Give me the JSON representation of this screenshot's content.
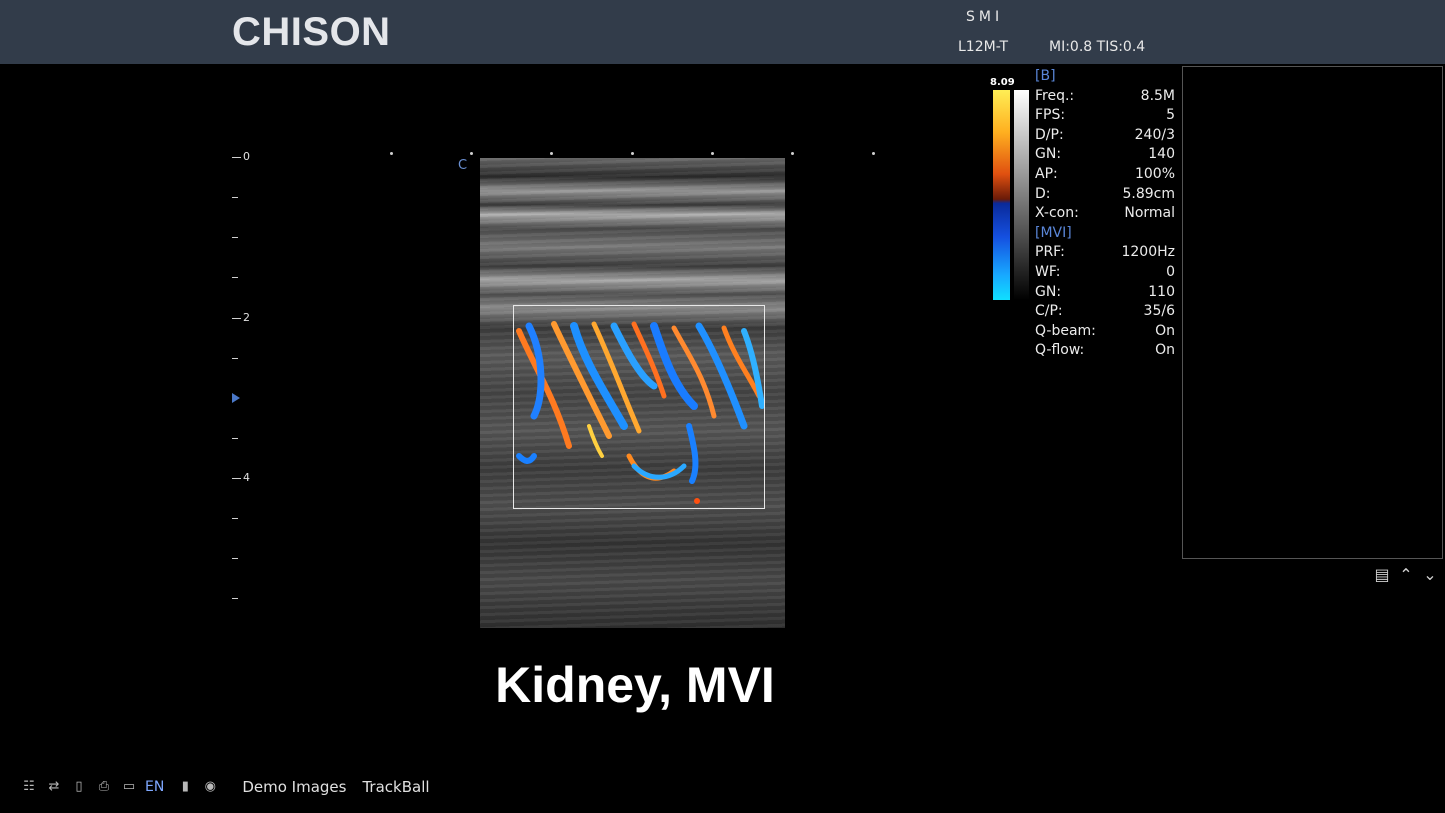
{
  "header": {
    "brand": "CHISON",
    "mode": "SMI",
    "probe": "L12M-T",
    "mi_tis": "MI:0.8 TIS:0.4"
  },
  "ruler": {
    "labels": [
      "0",
      "2",
      "4"
    ],
    "orientation_marker": "C"
  },
  "colorbar": {
    "max_label": "8.09"
  },
  "params": {
    "b_section": "[B]",
    "b_rows": [
      {
        "label": "Freq.:",
        "value": "8.5M"
      },
      {
        "label": "FPS:",
        "value": "5"
      },
      {
        "label": "D/P:",
        "value": "240/3"
      },
      {
        "label": "GN:",
        "value": "140"
      },
      {
        "label": "AP:",
        "value": "100%"
      },
      {
        "label": "D:",
        "value": "5.89cm"
      },
      {
        "label": "X-con:",
        "value": "Normal"
      }
    ],
    "mvi_section": "[MVI]",
    "mvi_rows": [
      {
        "label": "PRF:",
        "value": "1200Hz"
      },
      {
        "label": "WF:",
        "value": "0"
      },
      {
        "label": "GN:",
        "value": "110"
      },
      {
        "label": "C/P:",
        "value": "35/6"
      },
      {
        "label": "Q-beam:",
        "value": "On"
      },
      {
        "label": "Q-flow:",
        "value": "On"
      }
    ]
  },
  "caption": "Kidney, MVI",
  "status": {
    "icons": [
      "network-icon",
      "usb-icon",
      "storage-icon",
      "printer-icon",
      "monitor-icon",
      "battery-icon",
      "globe-icon"
    ],
    "language": "EN",
    "items": [
      "Demo Images",
      "TrackBall"
    ]
  },
  "colors": {
    "header_bg": "#323c4a",
    "section_label": "#5a86d8",
    "status_lang": "#7fa8ff"
  }
}
